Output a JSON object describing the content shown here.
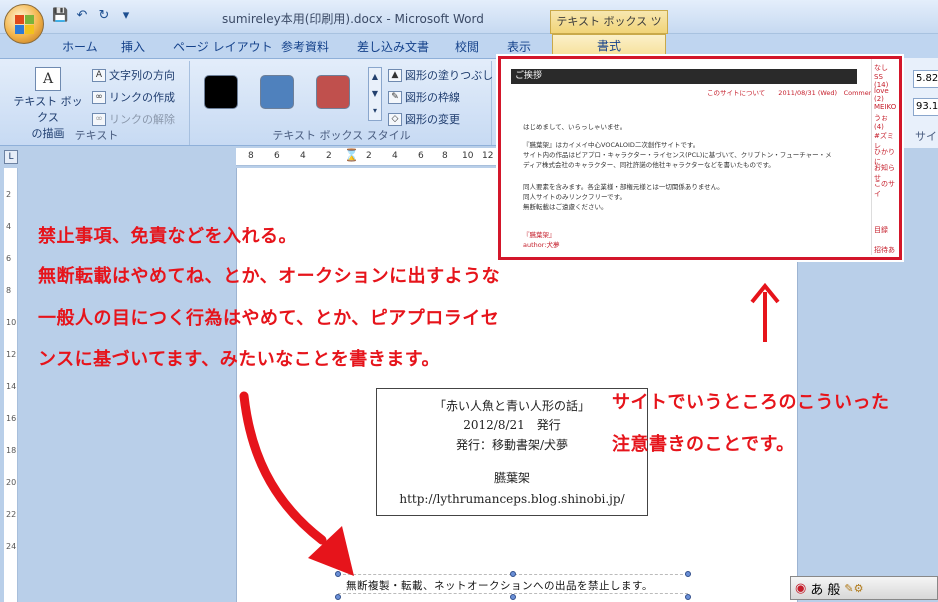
{
  "window": {
    "title": "sumireley本用(印刷用).docx - Microsoft Word",
    "context_tab_title": "テキスト ボックス ツール"
  },
  "tabs": [
    "ホーム",
    "挿入",
    "ページ レイアウト",
    "参考資料",
    "差し込み文書",
    "校閲",
    "表示"
  ],
  "active_tab": "書式",
  "ribbon": {
    "text_group": {
      "draw_textbox_label_1": "テキスト ボックス",
      "draw_textbox_label_2": "の描画",
      "text_direction": "文字列の方向",
      "create_link": "リンクの作成",
      "break_link": "リンクの解除",
      "group_label": "テキスト"
    },
    "style_group": {
      "fill": "図形の塗りつぶし",
      "outline": "図形の枠線",
      "change_shape": "図形の変更",
      "group_label": "テキスト ボックス スタイル",
      "swatch_colors": [
        "#000000",
        "#4f81bd",
        "#c0504d"
      ]
    },
    "side": {
      "value_1": "5.82",
      "value_2": "93.13",
      "group_label": "サイ"
    }
  },
  "ruler": {
    "ticks": [
      "8",
      "6",
      "4",
      "2",
      "2",
      "4",
      "6",
      "8",
      "10",
      "12"
    ]
  },
  "left_ruler": {
    "ticks": [
      "2",
      "4",
      "6",
      "8",
      "10",
      "12",
      "14",
      "16",
      "18",
      "20",
      "22",
      "24"
    ]
  },
  "annotation": {
    "line_1": "禁止事項、免責などを入れる。",
    "line_2": "無断転載はやめてね、とか、オークションに出すような",
    "line_3": "一般人の目につく行為はやめて、とか、ピアプロライセ",
    "line_4": "ンスに基づいてます、みたいなことを書きます。",
    "right_line_1": "サイトでいうところのこういった",
    "right_line_2": "注意書きのことです。"
  },
  "colophon": {
    "title": "「赤い人魚と青い人形の話」",
    "date": "2012/8/21　発行",
    "publisher": "発行：移動書架/犬夢",
    "circle": "臙葉架",
    "url": "http://lythrumanceps.blog.shinobi.jp/"
  },
  "notice": "無断複製・転載、ネットオークションへの出品を禁止します。",
  "inset": {
    "header": "ご挨拶",
    "nav": "このサイトについて　　2011/08/31 (Wed)　Comment(0)",
    "p1": "はじめまして、いらっしゃいませ。",
    "p2a": "『臙葉架』はカイメイ中心VOCALOID二次創作サイトです。",
    "p2b": "サイト内の作品はピアプロ・キャラクター・ライセンス(PCL)に基づいて、クリプトン・フューチャー・メ",
    "p2c": "ディア株式会社のキャラクター、同社許諾の他社キャラクターなどを書いたものです。",
    "p3a": "同人要素を含みます。各企業様・部権元様とは一切関係ありません。",
    "p3b": "同人サイトのみリンクフリーです。",
    "p3c": "無断転載はご遠慮ください。",
    "sig1": "『臙葉架』",
    "sig2": "author:犬夢",
    "side_items": [
      "なし",
      "SS (14)",
      "love (2)",
      "MEIKO",
      "うぉ (4)",
      "#ズミレ",
      "ひかりに",
      "お知らせ",
      "このサイ",
      "目録",
      "招待あ"
    ]
  },
  "ime": {
    "mode": "あ",
    "kanji": "般"
  }
}
